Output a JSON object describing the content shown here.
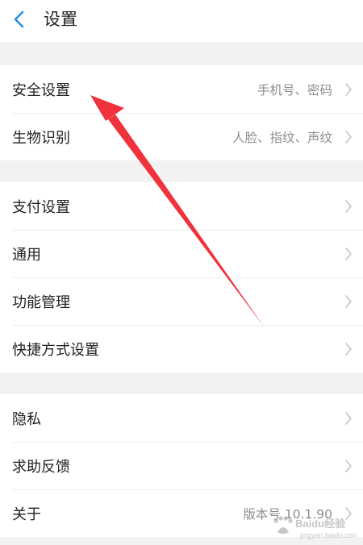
{
  "header": {
    "title": "设置"
  },
  "groups": [
    {
      "items": [
        {
          "label": "安全设置",
          "value": "手机号、密码"
        },
        {
          "label": "生物识别",
          "value": "人脸、指纹、声纹"
        }
      ]
    },
    {
      "items": [
        {
          "label": "支付设置",
          "value": ""
        },
        {
          "label": "通用",
          "value": ""
        },
        {
          "label": "功能管理",
          "value": ""
        },
        {
          "label": "快捷方式设置",
          "value": ""
        }
      ]
    },
    {
      "items": [
        {
          "label": "隐私",
          "value": ""
        },
        {
          "label": "求助反馈",
          "value": ""
        },
        {
          "label": "关于",
          "value": "版本号 10.1.90"
        }
      ]
    }
  ],
  "watermark": {
    "brand": "Baidu经验",
    "url": "jingyan.baidu.com"
  },
  "colors": {
    "accent": "#1e8fe1",
    "arrow": "#f0323c",
    "background": "#f2f2f2",
    "text": "#222222",
    "subtext": "#8c8c8c"
  }
}
